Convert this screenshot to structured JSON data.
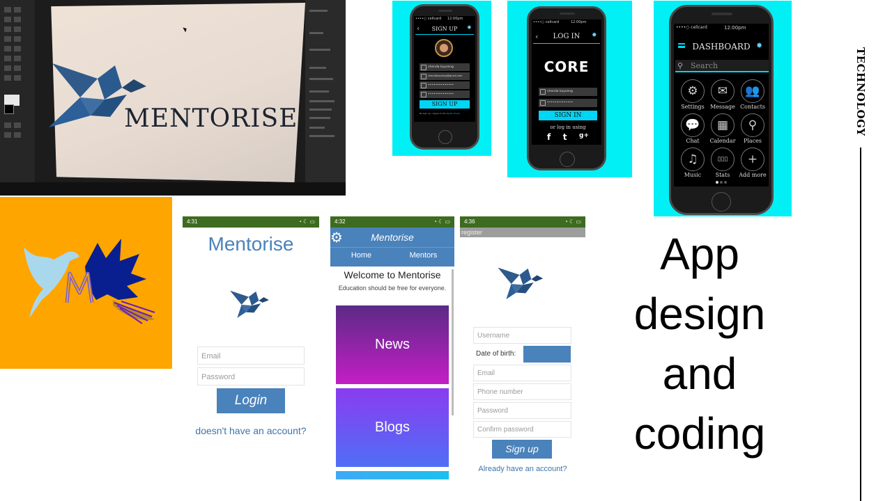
{
  "monitor_photo": {
    "logo_word": "MENTORISE"
  },
  "signup_phone": {
    "carrier": "••••○ cellcard",
    "time": "12:00pm",
    "title": "SIGN UP",
    "back_glyph": "‹",
    "fields": [
      "chenda kuyseng",
      "chendakuyseng@gmail.com",
      "••••••••••••••",
      "••••••••••••••"
    ],
    "button": "SIGN UP",
    "terms_prefix": "By sign up, I agree to the",
    "terms_link": "terms of use"
  },
  "login_phone": {
    "carrier": "••••○ cellcard",
    "time": "12:00pm",
    "title": "LOG IN",
    "back_glyph": "‹",
    "brand": "CORE",
    "fields": [
      "chenda kuyseng",
      "••••••••••••••"
    ],
    "button": "SIGN IN",
    "or_text": "or log in using",
    "social": [
      "f",
      "t",
      "g+"
    ]
  },
  "dashboard_phone": {
    "carrier": "••••○ cellcard",
    "time": "12:00pm",
    "title": "DASHBOARD",
    "search_placeholder": "Search",
    "tiles": [
      {
        "label": "Settings",
        "glyph": "⚙"
      },
      {
        "label": "Message",
        "glyph": "✉"
      },
      {
        "label": "Contacts",
        "glyph": "👥"
      },
      {
        "label": "Chat",
        "glyph": "💬"
      },
      {
        "label": "Calendar",
        "glyph": "▦"
      },
      {
        "label": "Places",
        "glyph": "⚲"
      },
      {
        "label": "Music",
        "glyph": "♫"
      },
      {
        "label": "Stats",
        "glyph": "▯▯▯"
      },
      {
        "label": "Add more",
        "glyph": "+"
      }
    ]
  },
  "login_screen": {
    "status_time": "4:31",
    "status_icons": "◔ ☾ ▭",
    "title": "Mentorise",
    "email_placeholder": "Email",
    "password_placeholder": "Password",
    "login_button": "Login",
    "register_link": "doesn't have an account?"
  },
  "home_screen": {
    "status_time": "4:32",
    "status_icons": "◔ ☾ ▭",
    "title": "Mentorise",
    "tabs": [
      "Home",
      "Mentors"
    ],
    "welcome": "Welcome to Mentorise",
    "tagline": "Education should be free for everyone.",
    "cards": [
      "News",
      "Blogs"
    ],
    "colors": {
      "header": "#4a82bb",
      "news_top": "#5b2a86",
      "news_bottom": "#c41ec6",
      "blogs_top": "#8a3cf0",
      "blogs_bottom": "#4f6ff5"
    }
  },
  "register_screen": {
    "status_time": "4:36",
    "status_icons": "◔ ☾ ▭",
    "subtitle": "register",
    "username_placeholder": "Username",
    "dob_label": "Date of birth:",
    "email_placeholder": "Email",
    "phone_placeholder": "Phone number",
    "password_placeholder": "Password",
    "confirm_placeholder": "Confirm password",
    "signup_button": "Sign up",
    "login_link": "Already have an account?"
  },
  "slide_text": {
    "heading_lines": [
      "App",
      "design",
      "and",
      "coding"
    ],
    "section_label": "TECHNOLOGY"
  },
  "colors": {
    "mockup_background": "#00f0f5",
    "logo_tile": "#ffa500",
    "brand_blue": "#4a82bb",
    "status_bar": "#3d6b1f"
  }
}
